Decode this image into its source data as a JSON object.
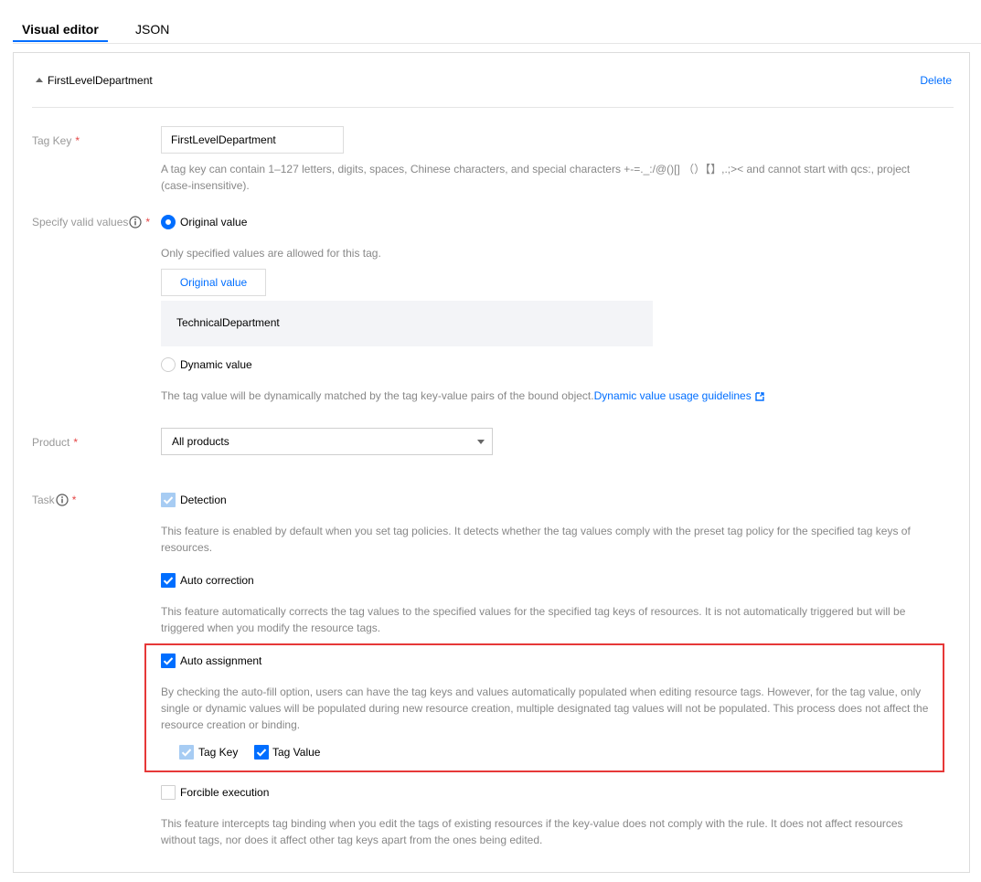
{
  "tabs": {
    "visual_editor": "Visual editor",
    "json": "JSON"
  },
  "section": {
    "title": "FirstLevelDepartment",
    "delete": "Delete"
  },
  "tag_key": {
    "label": "Tag Key",
    "required_mark": "*",
    "value": "FirstLevelDepartment",
    "help_line1": "A tag key can contain 1–127 letters, digits, spaces, Chinese characters, and special characters +-=._:/@()[] （）【】,.;>< and cannot start with qcs:, project",
    "help_line2": "(case-insensitive)."
  },
  "valid_values": {
    "label": "Specify valid values",
    "required_mark": "*",
    "original": {
      "label": "Original value",
      "help": "Only specified values are allowed for this tag.",
      "button": "Original value",
      "values": [
        "TechnicalDepartment"
      ]
    },
    "dynamic": {
      "label": "Dynamic value",
      "help": "The tag value will be dynamically matched by the tag key-value pairs of the bound object.",
      "link": "Dynamic value usage guidelines"
    }
  },
  "product": {
    "label": "Product",
    "required_mark": "*",
    "selected": "All products"
  },
  "task": {
    "label": "Task",
    "required_mark": "*",
    "detection": {
      "label": "Detection",
      "checked": true,
      "disabled": true,
      "help_line1": "This feature is enabled by default when you set tag policies. It detects whether the tag values comply with the preset tag policy for the specified tag keys of",
      "help_line2": "resources."
    },
    "auto_correction": {
      "label": "Auto correction",
      "checked": true,
      "help_line1": "This feature automatically corrects the tag values to the specified values for the specified tag keys of resources. It is not automatically triggered but will be",
      "help_line2": "triggered when you modify the resource tags."
    },
    "auto_assignment": {
      "label": "Auto assignment",
      "checked": true,
      "help_line1": "By checking the auto-fill option, users can have the tag keys and values automatically populated when editing resource tags. However, for the tag value, only",
      "help_line2": "single or dynamic values will be populated during new resource creation, multiple designated tag values will not be populated. This process does not affect the",
      "help_line3": "resource creation or binding.",
      "tag_key": {
        "label": "Tag Key",
        "checked": true,
        "disabled": true
      },
      "tag_value": {
        "label": "Tag Value",
        "checked": true
      }
    },
    "forcible_execution": {
      "label": "Forcible execution",
      "checked": false,
      "help_line1": "This feature intercepts tag binding when you edit the tags of existing resources if the key-value does not comply with the rule. It does not affect resources",
      "help_line2": "without tags, nor does it affect other tag keys apart from the ones being edited."
    }
  },
  "colors": {
    "accent": "#006eff",
    "required": "#e54545",
    "highlight_border": "#e63838",
    "muted_text": "#888888"
  }
}
